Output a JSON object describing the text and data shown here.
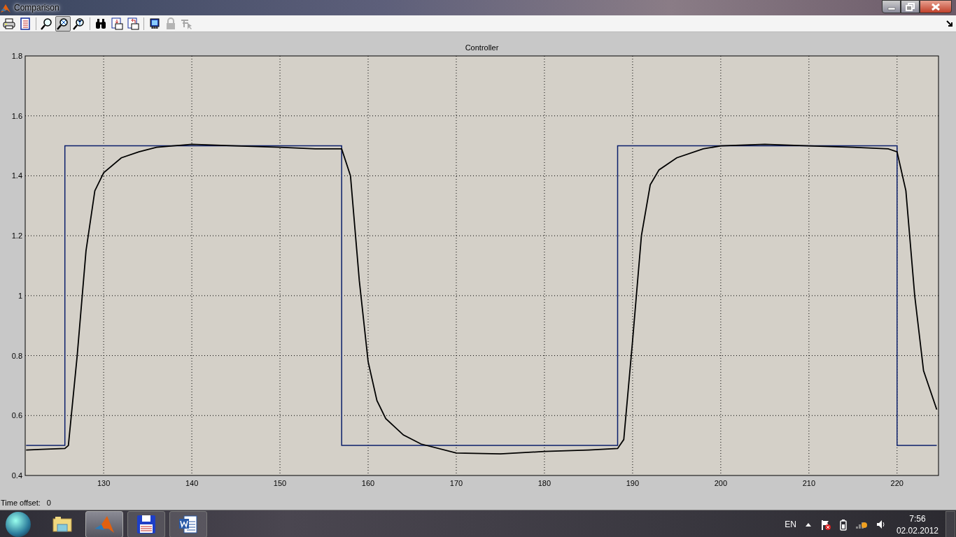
{
  "window": {
    "title": "Comparison"
  },
  "toolbar": [
    {
      "kind": "printer",
      "selected": false,
      "disabled": false
    },
    {
      "kind": "document",
      "selected": false,
      "disabled": false
    },
    {
      "kind": "separator"
    },
    {
      "kind": "zoom-in",
      "selected": false,
      "disabled": false
    },
    {
      "kind": "zoom-x",
      "selected": true,
      "disabled": false
    },
    {
      "kind": "zoom-y",
      "selected": false,
      "disabled": false
    },
    {
      "kind": "separator"
    },
    {
      "kind": "binoculars",
      "selected": false,
      "disabled": false
    },
    {
      "kind": "restore-in",
      "selected": false,
      "disabled": false
    },
    {
      "kind": "restore-out",
      "selected": false,
      "disabled": false
    },
    {
      "kind": "separator"
    },
    {
      "kind": "chip",
      "selected": false,
      "disabled": false
    },
    {
      "kind": "lock",
      "selected": false,
      "disabled": true
    },
    {
      "kind": "cursor",
      "selected": false,
      "disabled": true
    }
  ],
  "plot": {
    "chart_data": {
      "type": "line",
      "title": "Controller",
      "xlim": [
        121.1,
        224.7
      ],
      "ylim": [
        0.4,
        1.8
      ],
      "xticks": [
        130,
        140,
        150,
        160,
        170,
        180,
        190,
        200,
        210,
        220
      ],
      "yticks": [
        {
          "value": 0.4,
          "label": "0.4"
        },
        {
          "value": 0.6,
          "label": "0.6"
        },
        {
          "value": 0.8,
          "label": "0.8"
        },
        {
          "value": 1,
          "label": "1"
        },
        {
          "value": 1.2,
          "label": "1.2"
        },
        {
          "value": 1.4,
          "label": "1.4"
        },
        {
          "value": 1.6,
          "label": "1.6"
        },
        {
          "value": 1.8,
          "label": "1.8"
        }
      ],
      "grid": true,
      "x": [
        121.2,
        123,
        125.6,
        125.6,
        126,
        127,
        128,
        129,
        130,
        132,
        134,
        136,
        140,
        145,
        150,
        154,
        157,
        157,
        158,
        159,
        160,
        161,
        162,
        164,
        166,
        170,
        175,
        180,
        185,
        188.3,
        188.3,
        189,
        190,
        191,
        192,
        193,
        195,
        198,
        200,
        205,
        210,
        215,
        219,
        220,
        220,
        221,
        222,
        223,
        224.5
      ],
      "series": [
        {
          "color": "#0b1f6b",
          "values": [
            0.5,
            0.5,
            0.5,
            1.5,
            1.5,
            1.5,
            1.5,
            1.5,
            1.5,
            1.5,
            1.5,
            1.5,
            1.5,
            1.5,
            1.5,
            1.5,
            1.5,
            0.5,
            0.5,
            0.5,
            0.5,
            0.5,
            0.5,
            0.5,
            0.5,
            0.5,
            0.5,
            0.5,
            0.5,
            0.5,
            1.5,
            1.5,
            1.5,
            1.5,
            1.5,
            1.5,
            1.5,
            1.5,
            1.5,
            1.5,
            1.5,
            1.5,
            1.5,
            1.5,
            0.5,
            0.5,
            0.5,
            0.5,
            0.5
          ]
        },
        {
          "color": "#000000",
          "values": [
            0.485,
            0.487,
            0.49,
            0.49,
            0.5,
            0.8,
            1.15,
            1.35,
            1.41,
            1.46,
            1.48,
            1.495,
            1.505,
            1.5,
            1.495,
            1.49,
            1.49,
            1.49,
            1.4,
            1.05,
            0.78,
            0.65,
            0.59,
            0.535,
            0.505,
            0.475,
            0.472,
            0.48,
            0.485,
            0.49,
            0.49,
            0.52,
            0.85,
            1.2,
            1.37,
            1.42,
            1.46,
            1.49,
            1.5,
            1.505,
            1.5,
            1.495,
            1.49,
            1.48,
            1.48,
            1.35,
            1.0,
            0.75,
            0.62
          ]
        }
      ]
    }
  },
  "time_offset": {
    "label": "Time offset:",
    "value": "0"
  },
  "taskbar": {
    "apps": [
      {
        "kind": "explorer",
        "selected": false
      },
      {
        "kind": "matlab",
        "selected": true
      },
      {
        "kind": "floppy",
        "selected": false
      },
      {
        "kind": "word",
        "selected": false
      }
    ],
    "language": "EN",
    "time": "7:56",
    "date": "02.02.2012"
  }
}
